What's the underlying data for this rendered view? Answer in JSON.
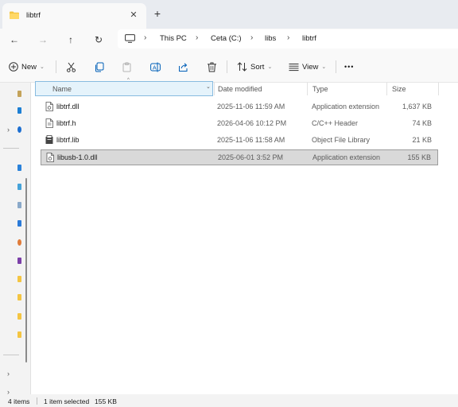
{
  "tab": {
    "title": "libtrf",
    "close_glyph": "✕",
    "new_tab_glyph": "+"
  },
  "nav": {
    "back_glyph": "←",
    "forward_glyph": "→",
    "up_glyph": "↑",
    "refresh_glyph": "↻"
  },
  "breadcrumb": [
    "This PC",
    "Ceta (C:)",
    "libs",
    "libtrf"
  ],
  "toolbar": {
    "new_label": "New",
    "sort_label": "Sort",
    "view_label": "View",
    "more_glyph": "•••"
  },
  "columns": {
    "name": "Name",
    "date": "Date modified",
    "type": "Type",
    "size": "Size"
  },
  "files": [
    {
      "name": "libtrf.dll",
      "date": "2025-11-06 11:59 AM",
      "type": "Application extension",
      "size": "1,637 KB",
      "icon": "dll-file-icon",
      "selected": false
    },
    {
      "name": "libtrf.h",
      "date": "2026-04-06 10:12 PM",
      "type": "C/C++ Header",
      "size": "74 KB",
      "icon": "header-file-icon",
      "selected": false
    },
    {
      "name": "libtrf.lib",
      "date": "2025-11-06 11:58 AM",
      "type": "Object File Library",
      "size": "21 KB",
      "icon": "lib-file-icon",
      "selected": false
    },
    {
      "name": "libusb-1.0.dll",
      "date": "2025-06-01 3:52 PM",
      "type": "Application extension",
      "size": "155 KB",
      "icon": "dll-file-icon",
      "selected": true
    }
  ],
  "status": {
    "items": "4 items",
    "selected": "1 item selected",
    "selected_size": "155 KB"
  },
  "colors": {
    "accent": "#005fb8",
    "folder": "#f4c542",
    "selection": "#d9d9d9",
    "header_highlight": "#e5f3fb"
  }
}
